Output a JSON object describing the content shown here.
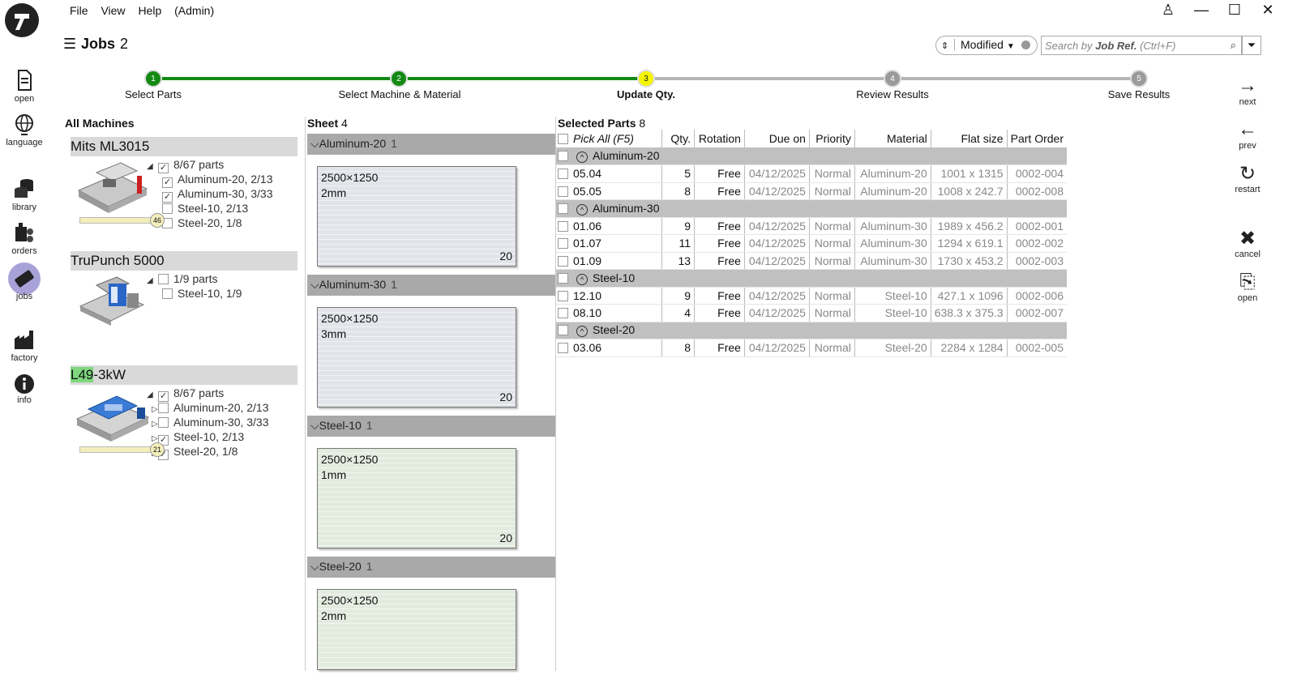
{
  "menu": {
    "file": "File",
    "view": "View",
    "help": "Help",
    "admin": "(Admin)"
  },
  "nav": [
    {
      "label": "open",
      "icon": "document-icon"
    },
    {
      "label": "language",
      "icon": "globe-icon"
    },
    {
      "label": "library",
      "icon": "database-icon"
    },
    {
      "label": "orders",
      "icon": "orders-icon"
    },
    {
      "label": "jobs",
      "icon": "jobs-icon"
    },
    {
      "label": "factory",
      "icon": "factory-icon"
    },
    {
      "label": "info",
      "icon": "info-icon"
    }
  ],
  "header": {
    "title": "Jobs",
    "count": "2"
  },
  "sort": {
    "label": "Modified"
  },
  "search": {
    "prefix": "Search by ",
    "bold": "Job Ref.",
    "suffix": " (Ctrl+F)"
  },
  "steps": [
    {
      "num": "1",
      "label": "Select Parts",
      "state": "done"
    },
    {
      "num": "2",
      "label": "Select Machine & Material",
      "state": "done"
    },
    {
      "num": "3",
      "label": "Update Qty.",
      "state": "current"
    },
    {
      "num": "4",
      "label": "Review Results",
      "state": "todo"
    },
    {
      "num": "5",
      "label": "Save Results",
      "state": "todo"
    }
  ],
  "actions": [
    {
      "label": "next",
      "icon": "→"
    },
    {
      "label": "prev",
      "icon": "←"
    },
    {
      "label": "restart",
      "icon": "↻"
    },
    {
      "label": "cancel",
      "icon": "✖"
    },
    {
      "label": "open",
      "icon": "⎘"
    }
  ],
  "machines": {
    "title": "All Machines",
    "list": [
      {
        "name": "Mits ML3015",
        "progress": "46",
        "parts": "8/67 parts",
        "items": [
          "Aluminum-20, 2/13",
          "Aluminum-30, 3/33",
          "Steel-10, 2/13",
          "Steel-20, 1/8"
        ],
        "checked": [
          true,
          true,
          false,
          false
        ]
      },
      {
        "name": "TruPunch 5000",
        "parts": "1/9 parts",
        "items": [
          "Steel-10, 1/9"
        ],
        "checked": [
          false
        ]
      },
      {
        "name_hl": "L49",
        "name_rest": "-3kW",
        "progress": "21",
        "parts": "8/67 parts",
        "items": [
          "Aluminum-20, 2/13",
          "Aluminum-30, 3/33",
          "Steel-10, 2/13",
          "Steel-20, 1/8"
        ],
        "checked": [
          false,
          false,
          true,
          true
        ]
      }
    ]
  },
  "sheets": {
    "title": "Sheet",
    "count": "4",
    "groups": [
      {
        "name": "Aluminum-20",
        "count": "1",
        "size": "2500×1250",
        "thick": "2mm",
        "qty": "20"
      },
      {
        "name": "Aluminum-30",
        "count": "1",
        "size": "2500×1250",
        "thick": "3mm",
        "qty": "20"
      },
      {
        "name": "Steel-10",
        "count": "1",
        "size": "2500×1250",
        "thick": "1mm",
        "qty": "20"
      },
      {
        "name": "Steel-20",
        "count": "1",
        "size": "2500×1250",
        "thick": "2mm",
        "qty": ""
      }
    ]
  },
  "parts": {
    "title": "Selected Parts",
    "count": "8",
    "columns": [
      "Pick All (F5)",
      "Qty.",
      "Rotation",
      "Due on",
      "Priority",
      "Material",
      "Flat size",
      "Part Order"
    ],
    "groups": [
      {
        "name": "Aluminum-20",
        "rows": [
          [
            "05.04",
            "5",
            "Free",
            "04/12/2025",
            "Normal",
            "Aluminum-20",
            "1001 x 1315",
            "0002-004"
          ],
          [
            "05.05",
            "8",
            "Free",
            "04/12/2025",
            "Normal",
            "Aluminum-20",
            "1008 x 242.7",
            "0002-008"
          ]
        ]
      },
      {
        "name": "Aluminum-30",
        "rows": [
          [
            "01.06",
            "9",
            "Free",
            "04/12/2025",
            "Normal",
            "Aluminum-30",
            "1989 x 456.2",
            "0002-001"
          ],
          [
            "01.07",
            "11",
            "Free",
            "04/12/2025",
            "Normal",
            "Aluminum-30",
            "1294 x 619.1",
            "0002-002"
          ],
          [
            "01.09",
            "13",
            "Free",
            "04/12/2025",
            "Normal",
            "Aluminum-30",
            "1730 x 453.2",
            "0002-003"
          ]
        ]
      },
      {
        "name": "Steel-10",
        "rows": [
          [
            "12.10",
            "9",
            "Free",
            "04/12/2025",
            "Normal",
            "Steel-10",
            "427.1 x 1096",
            "0002-006"
          ],
          [
            "08.10",
            "4",
            "Free",
            "04/12/2025",
            "Normal",
            "Steel-10",
            "638.3 x 375.3",
            "0002-007"
          ]
        ]
      },
      {
        "name": "Steel-20",
        "rows": [
          [
            "03.06",
            "8",
            "Free",
            "04/12/2025",
            "Normal",
            "Steel-20",
            "2284 x 1284",
            "0002-005"
          ]
        ]
      }
    ]
  },
  "colors": {
    "done": "#138a13",
    "current": "#f5f500",
    "todo": "#9a9a9a",
    "highlight": "#7ed67e"
  }
}
